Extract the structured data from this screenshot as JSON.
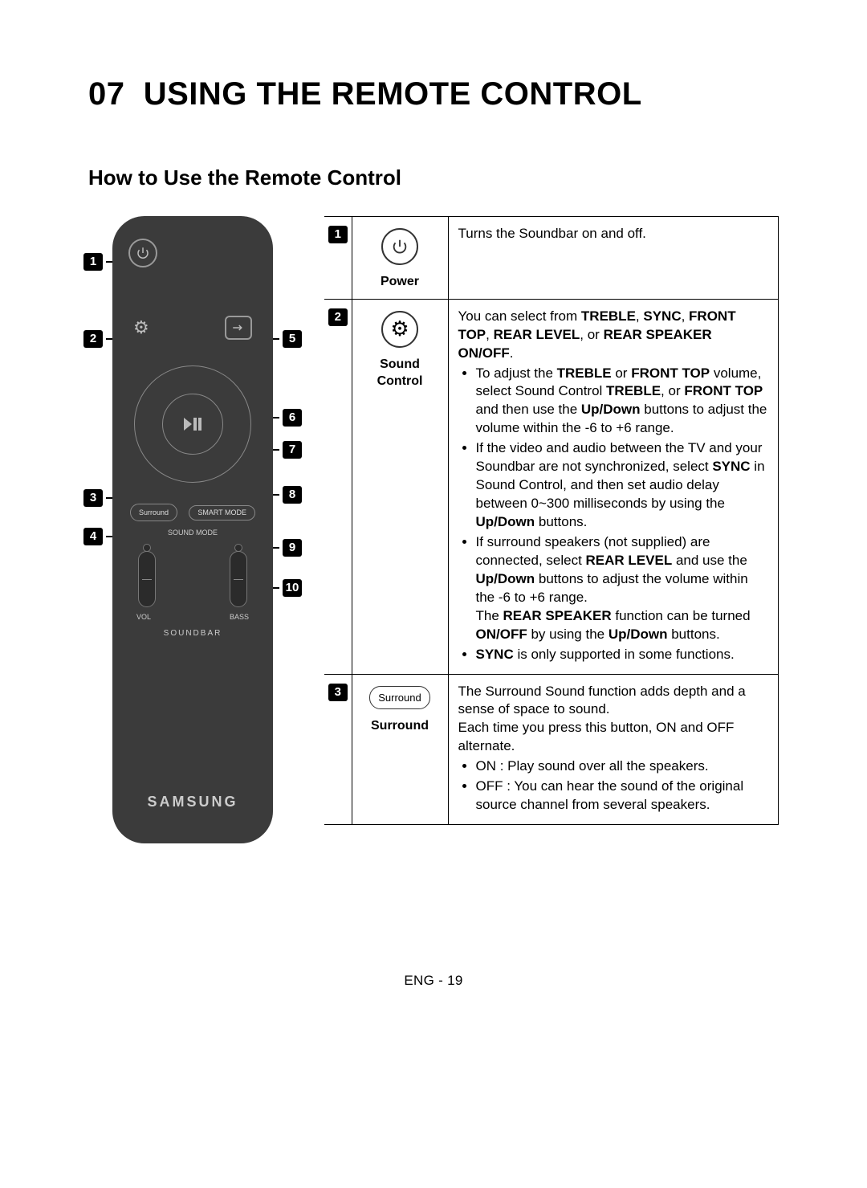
{
  "page": {
    "chapter_no": "07",
    "chapter_title": "USING THE REMOTE CONTROL",
    "subtitle": "How to Use the Remote Control",
    "footer": "ENG - 19"
  },
  "remote": {
    "button_surround": "Surround",
    "button_smart_mode": "SMART MODE",
    "label_sound_mode": "SOUND MODE",
    "slider_vol": "VOL",
    "slider_bass": "BASS",
    "brand_small": "SOUNDBAR",
    "brand_big": "SAMSUNG",
    "callouts": {
      "1": "1",
      "2": "2",
      "3": "3",
      "4": "4",
      "5": "5",
      "6": "6",
      "7": "7",
      "8": "8",
      "9": "9",
      "10": "10"
    }
  },
  "table": {
    "rows": [
      {
        "num": "1",
        "icon_label": "Power",
        "desc_plain": "Turns the Soundbar on and off."
      },
      {
        "num": "2",
        "icon_label": "Sound Control",
        "intro_pre": "You can select from ",
        "intro_bold1": "TREBLE",
        "intro_mid1": ", ",
        "intro_bold2": "SYNC",
        "intro_mid2": ", ",
        "intro_bold3": "FRONT TOP",
        "intro_mid3": ", ",
        "intro_bold4": "REAR LEVEL",
        "intro_mid4": ", or ",
        "intro_bold5": "REAR SPEAKER ON/OFF",
        "intro_end": ".",
        "b1_a": "To adjust the ",
        "b1_b": "TREBLE",
        "b1_c": " or ",
        "b1_d": "FRONT TOP",
        "b1_e": " volume, select Sound Control ",
        "b1_f": "TREBLE",
        "b1_g": ", or ",
        "b1_h": "FRONT TOP",
        "b1_i": " and then use the ",
        "b1_j": "Up/Down",
        "b1_k": " buttons to adjust the volume within the -6 to +6 range.",
        "b2_a": "If the video and audio between the TV and your Soundbar are not synchronized, select ",
        "b2_b": "SYNC",
        "b2_c": " in Sound Control, and then set audio delay between 0~300 milliseconds by using the ",
        "b2_d": "Up/Down",
        "b2_e": " buttons.",
        "b3_a": "If surround speakers (not supplied) are connected, select ",
        "b3_b": "REAR LEVEL",
        "b3_c": " and use the ",
        "b3_d": "Up/Down",
        "b3_e": " buttons to adjust the volume within the -6 to +6 range.",
        "b3_f": "The ",
        "b3_g": "REAR SPEAKER",
        "b3_h": " function can be turned ",
        "b3_i": "ON/OFF",
        "b3_j": " by using the ",
        "b3_k": "Up/Down",
        "b3_l": " buttons.",
        "b4_a": "SYNC",
        "b4_b": " is only supported in some functions."
      },
      {
        "num": "3",
        "icon_pill": "Surround",
        "icon_label": "Surround",
        "p1": "The Surround Sound function adds depth and a sense of space to sound.",
        "p2": "Each time you press this button, ON and OFF alternate.",
        "b1": "ON : Play sound over all the speakers.",
        "b2": "OFF : You can hear the sound of the original source channel from several speakers."
      }
    ]
  }
}
